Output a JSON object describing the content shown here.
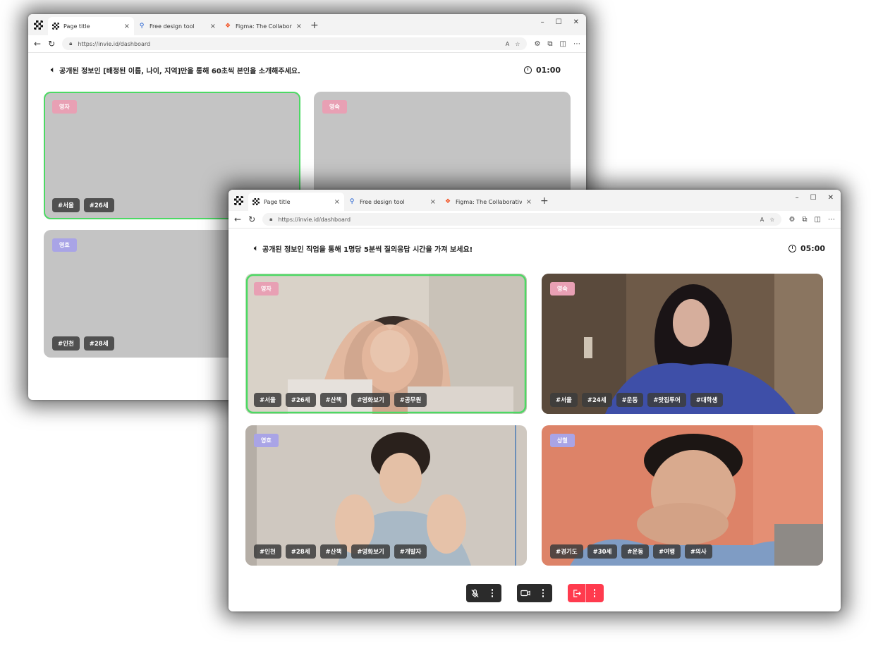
{
  "browser": {
    "tabs": [
      {
        "label": "Page title"
      },
      {
        "label": "Free design tool"
      },
      {
        "label": "Figma: The Collaborative"
      }
    ],
    "url": "https://invie.id/dashboard"
  },
  "back_window": {
    "prompt": "공개된 정보인 [배정된 이름, 나이, 지역]만을 통해 60초씩 본인을 소개해주세요.",
    "timer": "01:00",
    "participants": [
      {
        "name": "영자",
        "tags": [
          "#서울",
          "#26세"
        ],
        "badge_color": "#e8a0b4"
      },
      {
        "name": "영숙",
        "tags": [],
        "badge_color": "#e8a0b4"
      },
      {
        "name": "영호",
        "tags": [
          "#인천",
          "#28세"
        ],
        "badge_color": "#a9a4e6"
      }
    ]
  },
  "front_window": {
    "prompt": "공개된 정보인 직업을 통해 1명당 5분씩 질의응답 시간을 가져 보세요!",
    "timer": "05:00",
    "participants": [
      {
        "name": "영자",
        "tags": [
          "#서울",
          "#26세",
          "#산책",
          "#영화보기",
          "#공무원"
        ],
        "badge_color": "#e8a0b4"
      },
      {
        "name": "영숙",
        "tags": [
          "#서울",
          "#24세",
          "#운동",
          "#맛집투어",
          "#대학생"
        ],
        "badge_color": "#e8a0b4"
      },
      {
        "name": "영호",
        "tags": [
          "#인천",
          "#28세",
          "#산책",
          "#영화보기",
          "#개발자"
        ],
        "badge_color": "#a9a4e6"
      },
      {
        "name": "상철",
        "tags": [
          "#경기도",
          "#30세",
          "#운동",
          "#여행",
          "#의사"
        ],
        "badge_color": "#a9a4e6"
      }
    ]
  },
  "controls": {
    "mic": "microphone-muted-icon",
    "camera": "video-camera-icon",
    "leave": "exit-icon"
  },
  "colors": {
    "speaking_border": "#4cd964",
    "leave_button": "#ff3b4e",
    "control_dark": "#2b2b2b"
  }
}
